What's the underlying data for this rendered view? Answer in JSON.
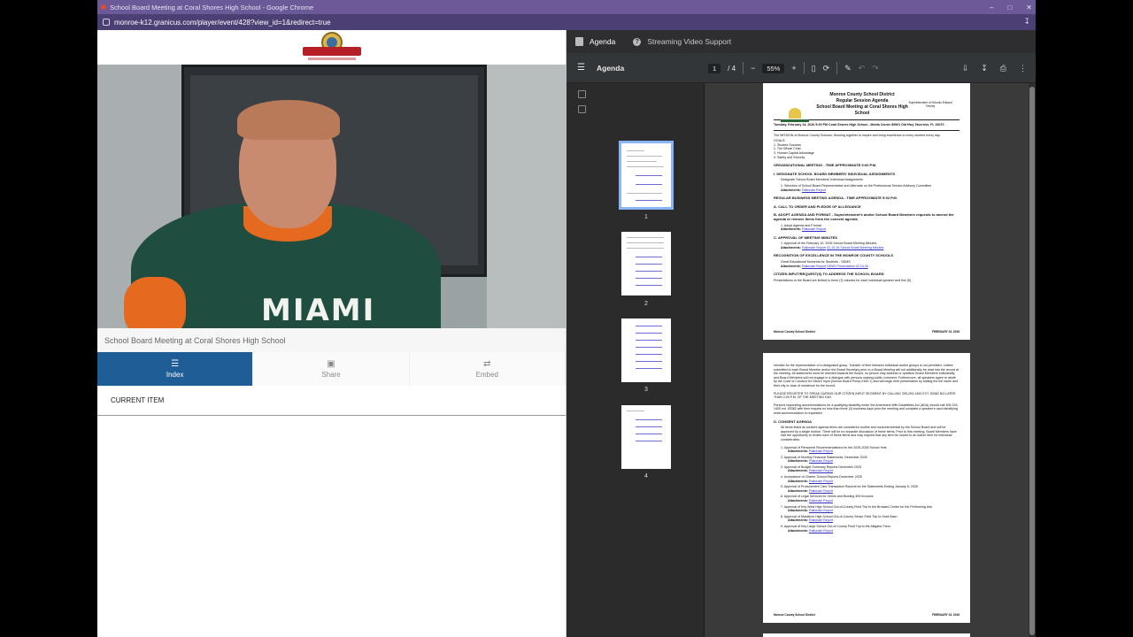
{
  "browser": {
    "window_title": "School Board Meeting at Coral Shores High School - Google Chrome",
    "url": "monroe-k12.granicus.com/player/event/428?view_id=1&redirect=true"
  },
  "player": {
    "event_title": "School Board Meeting at Coral Shores High School",
    "jersey_text": "MIAMI",
    "tabs": [
      {
        "label": "Index",
        "icon": "list-icon"
      },
      {
        "label": "Share",
        "icon": "share-icon"
      },
      {
        "label": "Embed",
        "icon": "embed-icon"
      }
    ],
    "current_item_label": "CURRENT ITEM"
  },
  "viewer": {
    "tabs": [
      {
        "label": "Agenda",
        "icon": "document-icon"
      },
      {
        "label": "Streaming Video Support",
        "icon": "help-icon"
      }
    ],
    "doc_name": "Agenda",
    "current_page": "1",
    "page_total": "/ 4",
    "zoom": "55%",
    "thumb_numbers": [
      "1",
      "2",
      "3",
      "4"
    ]
  },
  "page1": {
    "district": "Monroe County School District",
    "agenda_type": "Regular Session Agenda",
    "meeting": "School Board Meeting at Coral Shores High School",
    "superintendent": "Superintendent of Schools Edward Tierney",
    "header_row": "Tuesday, February 24, 2026     5:00 PM     Coral Shores High School - Media Center 89901 Old Hwy Tavernier, FL 33070",
    "mission": "The MISSION of Monroe County Schools: Working together to inspire and bring excellence to every student every day.",
    "goals_title": "GOALS:",
    "goals": [
      "1. Student Success",
      "2. The Whole Child",
      "3. Human Capital Advantage",
      "4. Safety and Security"
    ],
    "org_meeting": "ORGANIZATIONAL MEETING - TIME APPROXIMATE 5:00 P.M.",
    "sec_i": "I. DESIGNATE SCHOOL BOARD MEMBERS' INDIVIDUAL ASSIGNMENTS",
    "sec_i_text": "Designate School Board Members' Individual Assignments",
    "sec_i_item": "1. Selection of School Board Representative and Alternate on the Professional Service Advisory Committee",
    "attach_label": "Attachments:",
    "rationale": "Rationale Report",
    "regular": "REGULAR BUSINESS MEETING AGENDA - TIME APPROXIMATE 5:02 P.M.",
    "sec_a": "A. CALL TO ORDER AND PLEDGE OF ALLEGIANCE",
    "sec_b": "B. ADOPT AGENDA AND FORMAT - Superintendent's and/or School Board Members requests to amend the agenda or remove items from the consent agenda",
    "sec_b_item": "1. Adopt Agenda and Format",
    "sec_c": "C. APPROVAL OF MEETING MINUTES",
    "sec_c_item": "1. Approval of the February 10, 2026 School Board Meeting Minutes",
    "sec_c_link": "02-10-26 School Board Meeting Minutes",
    "recognition": "RECOGNITION OF EXCELLENCE IN THE MONROE COUNTY SCHOOLS",
    "recognition_text": "Great Educational Moments for Students - GEMS",
    "gems_link": "GEMS Presentation 02.24.26",
    "citizen": "CITIZEN INPUT/REQUEST(S) TO ADDRESS THE SCHOOL BOARD",
    "citizen_text": "Presentations to the Board are limited to three (3) minutes for each individual speaker and five (5)",
    "footer_left": "Monroe County School District",
    "footer_right": "FEBRUARY 24, 2026",
    "page_no": "1"
  },
  "page2": {
    "intro": "minutes for the representative of a designated group. Transfer of time between individual and/or groups is not permitted. Letters submitted to each Board Member and/or the Board Secretary prior to a Board Meeting will not additionally be read into the record at the meeting. All statements must be directed towards the Board, no person may address or question Board Members individually, and Board Members will not engage in a dialogue with persons making public comment. Furthermore, all speakers agree to abide by the Code of Conduct for Citizen Input (School Board Policy 0169.1) and will begin their presentation by stating the full name and their city or town of residence for the record.",
    "register": "PLEASE REGISTER TO SPEAK DURING OUR CITIZEN INPUT SEGMENT BY CALLING 305-293-1400 EXT. 53382 NO LATER THAN 2:00 P.M. OF THE MEETING DAY.",
    "ada": "Persons requesting accommodations for a qualifying disability under the Americans With Disabilities Act (ADA) should call 305-293-1400 ext. 53382 with their request no less than three (3) business days prior the meeting and complete a speaker's card identifying what accommodation is requested.",
    "sec_d": "D. CONSENT AGENDA",
    "sec_d_text": "All items listed as consent agenda items are considered routine and noncontroversial by the School Board and will be approved by a single motion. There will be no separate discussion of these items. Prior to this meeting, Board Members have had the opportunity to review each of these items and may request that any item be moved to an Action Item for individual consideration.",
    "items": [
      "1. Approval of Personnel Recommendations for the 2025-2026 School Year",
      "2. Approval of Monthly Financial Statements: December 2025",
      "3. Approval of Budget Summary Reports December 2025",
      "4. Acceptance of Charter School Reports December 2025",
      "5. Approval of Procurement Card Transaction Reports for the Statements Ending January 5, 2026",
      "6. Approval of Legal Services for Vernis and Bowling 309 Invoices",
      "7. Approval of Key West High School Out-of-County Field Trip to the Broward Center for the Performing Arts",
      "8. Approval of Marathon High School Out-of-County Senior Field Trip to Grad Bash",
      "9. Approval of Key Largo School Out-of-County Field Trip to the Alligator Farm"
    ],
    "footer_left": "Monroe County School District",
    "footer_right": "FEBRUARY 24, 2026",
    "page_no": "2"
  }
}
